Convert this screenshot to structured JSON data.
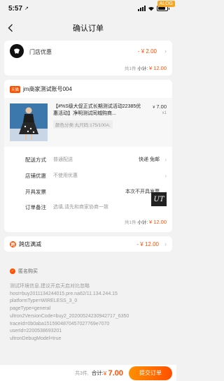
{
  "status_bar": {
    "time": "5:57",
    "location_arrow": "↗",
    "overlay_badge": "ALOG"
  },
  "nav": {
    "title": "确认订单"
  },
  "store_promo": {
    "label": "门店优惠",
    "discount": "- ¥ 2.00",
    "summary_count": "共1件",
    "summary_label": "小计:",
    "summary_amount": "¥ 12.00"
  },
  "shop": {
    "badge": "天猫",
    "name": "jm商家测试账号004",
    "item": {
      "title": "【#%S级大促正式长期测试活动22385优惠活动】净明测试同城购商...",
      "sku": "颜色分类:丸尺码:175/100A;",
      "price_symbol": "¥",
      "price": "7.00",
      "qty": "x1"
    },
    "rows": [
      {
        "key": "配送方式",
        "value": "普通配送",
        "right": "快递 免邮"
      },
      {
        "key": "店铺优惠",
        "value": "不使用优惠",
        "right": ""
      },
      {
        "key": "开具发票",
        "value": "",
        "right": "本次不开具发票"
      },
      {
        "key": "订单备注",
        "value": "选填,请先和商家协商一致",
        "right": ""
      }
    ],
    "note_logo": "UT",
    "summary_count": "共1件",
    "summary_label": "小计:",
    "summary_amount": "¥ 12.00"
  },
  "cross_store": {
    "icon": "跨",
    "label": "跨店满减",
    "discount": "- ¥ 12.00"
  },
  "anonymous": {
    "label": "匿名购买"
  },
  "debug_lines": [
    "测试环境信息,建议开启天启对比忽略",
    "host=buy2011134244015.pre.na62/11.134.244.15",
    "platformType=WIRELESS_3_0",
    "pageType=general",
    "ultron2VersionCode=buy2_20200524230942717_6350",
    "traceId=0b0aba1515904870457027769e7070",
    "userId=2200538693201",
    "ultronDebugModel=true"
  ],
  "bottom_bar": {
    "count": "共3件,",
    "total_label": "合计:",
    "currency": "¥",
    "total": "7.00",
    "submit_label": "提交订单"
  },
  "colors": {
    "accent": "#ff5000",
    "background": "#f2f2f2"
  }
}
